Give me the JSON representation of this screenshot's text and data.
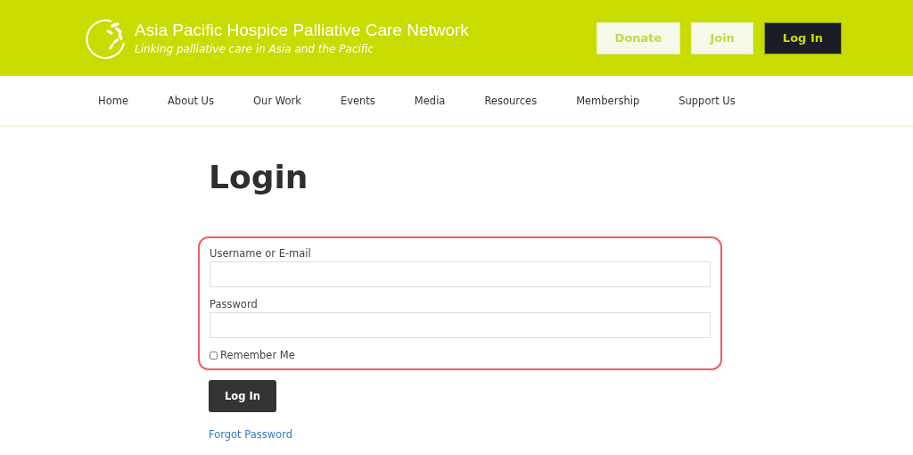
{
  "header": {
    "title": "Asia Pacific Hospice Palliative Care Network",
    "tagline": "Linking palliative care in Asia and the Pacific",
    "buttons": [
      {
        "label": "Donate",
        "kind": "light"
      },
      {
        "label": "Join",
        "kind": "light"
      },
      {
        "label": "Log In",
        "kind": "dark"
      }
    ]
  },
  "nav": {
    "items": [
      "Home",
      "About Us",
      "Our Work",
      "Events",
      "Media",
      "Resources",
      "Membership",
      "Support Us"
    ]
  },
  "login": {
    "heading": "Login",
    "fields": [
      {
        "label": "Username or E-mail"
      },
      {
        "label": "Password"
      }
    ],
    "remember": {
      "label": "Remember Me",
      "checked": false
    },
    "submit": "Log In",
    "forgot": "Forgot Password"
  }
}
